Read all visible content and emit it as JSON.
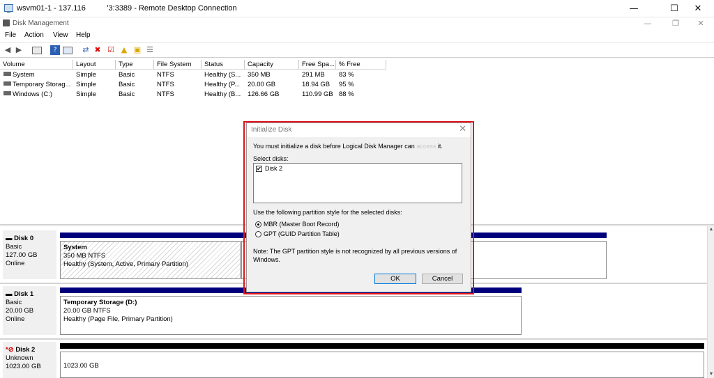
{
  "rdp": {
    "title_left": "wsvm01-1 - 137.116",
    "title_right": "'3:3389 - Remote Desktop Connection",
    "minimize": "—",
    "maximize": "☐",
    "close": "✕"
  },
  "app": {
    "title": "Disk Management",
    "minimize": "—",
    "restore": "❐",
    "close": "✕"
  },
  "menu": [
    "File",
    "Action",
    "View",
    "Help"
  ],
  "toolbar_icons": [
    "back-icon",
    "forward-icon",
    "console-icon",
    "help-icon",
    "properties-icon",
    "connect-icon",
    "delete-icon",
    "check-icon",
    "up-folder-icon",
    "rescan-icon",
    "list-icon"
  ],
  "volume_table": {
    "columns": [
      "Volume",
      "Layout",
      "Type",
      "File System",
      "Status",
      "Capacity",
      "Free Spa...",
      "% Free"
    ],
    "rows": [
      [
        "System",
        "Simple",
        "Basic",
        "NTFS",
        "Healthy (S...",
        "350 MB",
        "291 MB",
        "83 %"
      ],
      [
        "Temporary Storag...",
        "Simple",
        "Basic",
        "NTFS",
        "Healthy (P...",
        "20.00 GB",
        "18.94 GB",
        "95 %"
      ],
      [
        "Windows (C:)",
        "Simple",
        "Basic",
        "NTFS",
        "Healthy (B...",
        "126.66 GB",
        "110.99 GB",
        "88 %"
      ]
    ]
  },
  "disks": [
    {
      "name": "Disk 0",
      "type": "Basic",
      "size": "127.00 GB",
      "state": "Online",
      "partition": {
        "name": "System",
        "size": "350 MB NTFS",
        "status": "Healthy (System, Active, Primary Partition)"
      }
    },
    {
      "name": "Disk 1",
      "type": "Basic",
      "size": "20.00 GB",
      "state": "Online",
      "partition": {
        "name": "Temporary Storage  (D:)",
        "size": "20.00 GB NTFS",
        "status": "Healthy (Page File, Primary Partition)"
      }
    },
    {
      "name": "Disk 2",
      "type": "Unknown",
      "size": "1023.00 GB",
      "partition": {
        "size": "1023.00 GB"
      }
    }
  ],
  "dialog": {
    "title": "Initialize Disk",
    "intro_before": "You must initialize a disk before Logical Disk Manager can",
    "intro_blur": "access",
    "intro_after": "it.",
    "select_label": "Select disks:",
    "disk_item": "Disk 2",
    "style_label": "Use the following partition style for the selected disks:",
    "mbr_label": "MBR (Master Boot Record)",
    "gpt_label": "GPT (GUID Partition Table)",
    "note_line1": "Note: The GPT partition style is not recognized by all previous versions of",
    "note_line2": "Windows.",
    "ok": "OK",
    "cancel": "Cancel",
    "close": "✕"
  }
}
